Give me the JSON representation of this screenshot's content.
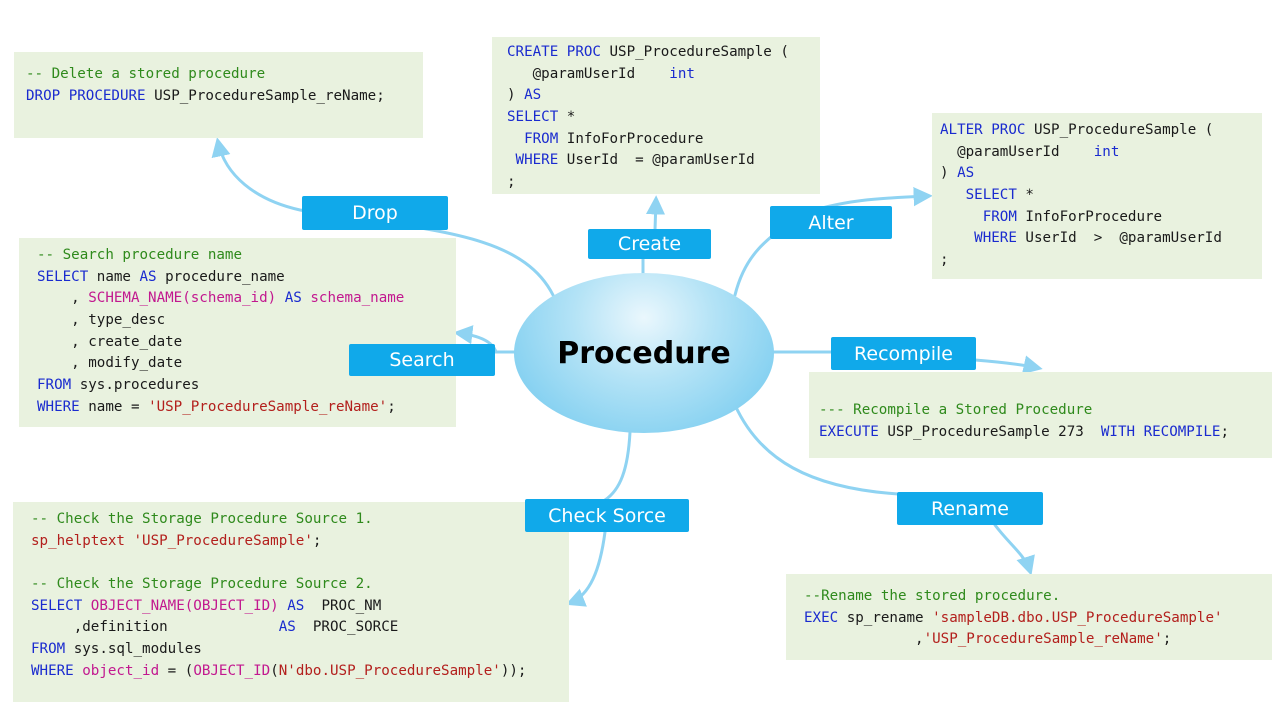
{
  "center": {
    "title": "Procedure"
  },
  "labels": {
    "drop": "Drop",
    "create": "Create",
    "alter": "Alter",
    "search": "Search",
    "recompile": "Recompile",
    "check_source": "Check Sorce",
    "rename": "Rename"
  },
  "colors": {
    "accent": "#10a9ea",
    "connector": "#8fd3f2",
    "code_background": "#e9f2df",
    "comment": "#2f8a1c",
    "keyword": "#1a2bcf",
    "function": "#c2188f",
    "string": "#b3201d"
  },
  "code": {
    "drop": [
      [
        [
          "c",
          "-- Delete a stored procedure"
        ]
      ],
      [
        [
          "k",
          "DROP PROCEDURE"
        ],
        [
          "",
          " USP_ProcedureSample_reName;"
        ]
      ]
    ],
    "create": [
      [
        [
          "k",
          "CREATE PROC"
        ],
        [
          "",
          " USP_ProcedureSample ("
        ]
      ],
      [
        [
          "",
          "   @paramUserId    "
        ],
        [
          "k",
          "int"
        ]
      ],
      [
        [
          "",
          ") "
        ],
        [
          "k",
          "AS"
        ]
      ],
      [
        [
          "k",
          "SELECT"
        ],
        [
          "",
          " *"
        ]
      ],
      [
        [
          "",
          "  "
        ],
        [
          "k",
          "FROM"
        ],
        [
          "",
          " InfoForProcedure"
        ]
      ],
      [
        [
          "",
          " "
        ],
        [
          "k",
          "WHERE"
        ],
        [
          "",
          " UserId  = @paramUserId"
        ]
      ],
      [
        [
          "",
          ";"
        ]
      ]
    ],
    "alter": [
      [
        [
          "k",
          "ALTER PROC"
        ],
        [
          "",
          " USP_ProcedureSample ("
        ]
      ],
      [
        [
          "",
          "  @paramUserId    "
        ],
        [
          "k",
          "int"
        ]
      ],
      [
        [
          "",
          ") "
        ],
        [
          "k",
          "AS"
        ]
      ],
      [
        [
          "",
          "   "
        ],
        [
          "k",
          "SELECT"
        ],
        [
          "",
          " *"
        ]
      ],
      [
        [
          "",
          "     "
        ],
        [
          "k",
          "FROM"
        ],
        [
          "",
          " InfoForProcedure"
        ]
      ],
      [
        [
          "",
          "    "
        ],
        [
          "k",
          "WHERE"
        ],
        [
          "",
          " UserId  >  @paramUserId"
        ]
      ],
      [
        [
          "",
          ";"
        ]
      ]
    ],
    "search": [
      [
        [
          "c",
          "-- Search procedure name"
        ]
      ],
      [
        [
          "k",
          "SELECT"
        ],
        [
          "",
          " name "
        ],
        [
          "k",
          "AS"
        ],
        [
          "",
          " procedure_name"
        ]
      ],
      [
        [
          "",
          "    , "
        ],
        [
          "f",
          "SCHEMA_NAME(schema_id)"
        ],
        [
          "",
          " "
        ],
        [
          "k",
          "AS"
        ],
        [
          "",
          " "
        ],
        [
          "f",
          "schema_name"
        ]
      ],
      [
        [
          "",
          "    , type_desc"
        ]
      ],
      [
        [
          "",
          "    , create_date"
        ]
      ],
      [
        [
          "",
          "    , modify_date"
        ]
      ],
      [
        [
          "k",
          "FROM"
        ],
        [
          "",
          " sys.procedures"
        ]
      ],
      [
        [
          "k",
          "WHERE"
        ],
        [
          "",
          " name = "
        ],
        [
          "s",
          "'USP_ProcedureSample_reName'"
        ],
        [
          "",
          ";"
        ]
      ]
    ],
    "recompile": [
      [
        [
          "c",
          "--- Recompile a Stored Procedure"
        ]
      ],
      [
        [
          "k",
          "EXECUTE"
        ],
        [
          "",
          " USP_ProcedureSample 273  "
        ],
        [
          "k",
          "WITH RECOMPILE"
        ],
        [
          "",
          ";"
        ]
      ]
    ],
    "check_source": [
      [
        [
          "c",
          "-- Check the Storage Procedure Source 1."
        ]
      ],
      [
        [
          "s",
          "sp_helptext 'USP_ProcedureSample'"
        ],
        [
          "",
          ";"
        ]
      ],
      [
        [
          "",
          " "
        ]
      ],
      [
        [
          "c",
          "-- Check the Storage Procedure Source 2."
        ]
      ],
      [
        [
          "k",
          "SELECT"
        ],
        [
          "",
          " "
        ],
        [
          "f",
          "OBJECT_NAME(OBJECT_ID)"
        ],
        [
          "",
          " "
        ],
        [
          "k",
          "AS"
        ],
        [
          "",
          "  PROC_NM"
        ]
      ],
      [
        [
          "",
          "     ,definition             "
        ],
        [
          "k",
          "AS"
        ],
        [
          "",
          "  PROC_SORCE"
        ]
      ],
      [
        [
          "k",
          "FROM"
        ],
        [
          "",
          " sys.sql_modules"
        ]
      ],
      [
        [
          "k",
          "WHERE"
        ],
        [
          "",
          " "
        ],
        [
          "f",
          "object_id"
        ],
        [
          "",
          " = ("
        ],
        [
          "f",
          "OBJECT_ID"
        ],
        [
          "",
          "("
        ],
        [
          "s",
          "N'dbo.USP_ProcedureSample'"
        ],
        [
          "",
          "));"
        ]
      ]
    ],
    "rename": [
      [
        [
          "c",
          "--Rename the stored procedure."
        ]
      ],
      [
        [
          "k",
          "EXEC"
        ],
        [
          "",
          " sp_rename "
        ],
        [
          "s",
          "'sampleDB.dbo.USP_ProcedureSample'"
        ]
      ],
      [
        [
          "",
          "             ,"
        ],
        [
          "s",
          "'USP_ProcedureSample_reName'"
        ],
        [
          "",
          ";"
        ]
      ]
    ]
  }
}
